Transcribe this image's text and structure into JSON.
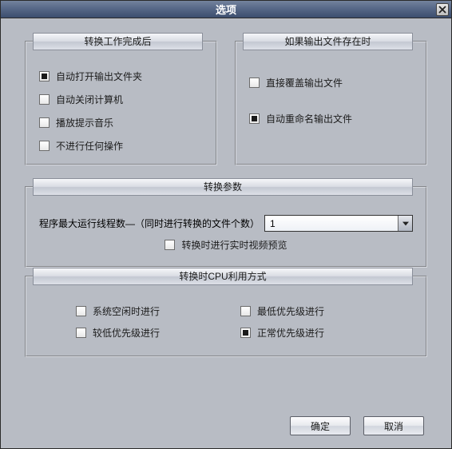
{
  "window": {
    "title": "选项"
  },
  "groups": {
    "after_convert": {
      "legend": "转换工作完成后",
      "items": [
        {
          "label": "自动打开输出文件夹",
          "checked": true
        },
        {
          "label": "自动关闭计算机",
          "checked": false
        },
        {
          "label": "播放提示音乐",
          "checked": false
        },
        {
          "label": "不进行任何操作",
          "checked": false
        }
      ]
    },
    "output_exists": {
      "legend": "如果输出文件存在时",
      "items": [
        {
          "label": "直接覆盖输出文件",
          "checked": false
        },
        {
          "label": "自动重命名输出文件",
          "checked": true
        }
      ]
    },
    "params": {
      "legend": "转换参数",
      "threads_label": "程序最大运行线程数—（同时进行转换的文件个数）",
      "threads_value": "1",
      "realtime_preview": {
        "label": "转换时进行实时视频预览",
        "checked": false
      }
    },
    "cpu_mode": {
      "legend": "转换时CPU利用方式",
      "items": [
        {
          "label": "系统空闲时进行",
          "checked": false
        },
        {
          "label": "最低优先级进行",
          "checked": false
        },
        {
          "label": "较低优先级进行",
          "checked": false
        },
        {
          "label": "正常优先级进行",
          "checked": true
        }
      ]
    }
  },
  "buttons": {
    "ok": "确定",
    "cancel": "取消"
  }
}
